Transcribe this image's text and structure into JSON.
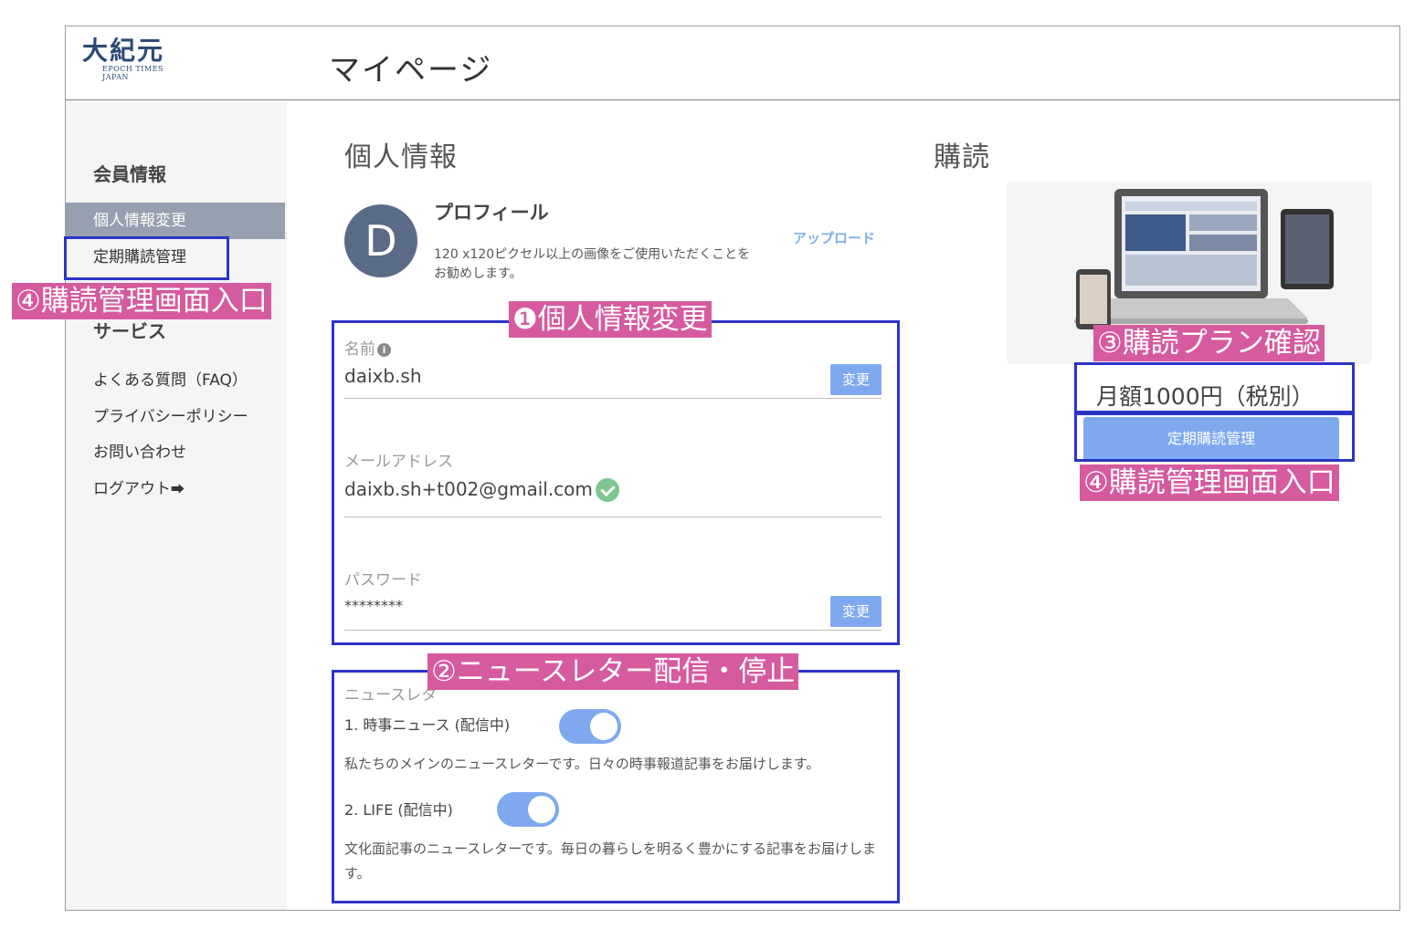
{
  "header": {
    "logo_text": "大紀元",
    "logo_sub": "EPOCH TIMES JAPAN",
    "title": "マイページ"
  },
  "sidebar": {
    "member_heading": "会員情報",
    "items": [
      {
        "label": "個人情報変更",
        "active": true
      },
      {
        "label": "定期購読管理",
        "active": false
      }
    ],
    "service_heading": "サービス",
    "links": [
      "よくある質問（FAQ）",
      "プライバシーポリシー",
      "お問い合わせ",
      "ログアウト"
    ],
    "logout_icon": "sign-out-icon"
  },
  "personal": {
    "title": "個人情報",
    "avatar_letter": "D",
    "profile_title": "プロフィール",
    "profile_desc": "120 x120ピクセル以上の画像をご使用いただくことをお勧めします。",
    "upload_label": "アップロード",
    "name_label": "名前",
    "name_value": "daixb.sh",
    "email_label": "メールアドレス",
    "email_value": "daixb.sh+t002@gmail.com",
    "password_label": "パスワード",
    "password_value": "********",
    "change_label": "変更"
  },
  "newsletter": {
    "heading": "ニュースレタ",
    "items": [
      {
        "label": "1. 時事ニュース (配信中)",
        "desc": "私たちのメインのニュースレターです。日々の時事報道記事をお届けします。",
        "enabled": true
      },
      {
        "label": "2. LIFE (配信中)",
        "desc": "文化面記事のニュースレターです。毎日の暮らしを明るく豊かにする記事をお届けします。",
        "enabled": true
      }
    ]
  },
  "subscription": {
    "title": "購読",
    "price": "月額1000円（税別）",
    "button_label": "定期購読管理"
  },
  "annotations": {
    "tag_sidebar": "④購読管理画面入口",
    "tag_personal": "❶個人情報変更",
    "tag_newsletter": "②ニュースレター配信・停止",
    "tag_plan": "③購読プラン確認",
    "tag_manage": "④購読管理画面入口"
  },
  "colors": {
    "accent": "#7fa9ef",
    "sidebar_active": "#97a0b0",
    "annotation_box": "#2c34c8",
    "annotation_tag": "#d65a9e",
    "avatar": "#5a6b88"
  }
}
